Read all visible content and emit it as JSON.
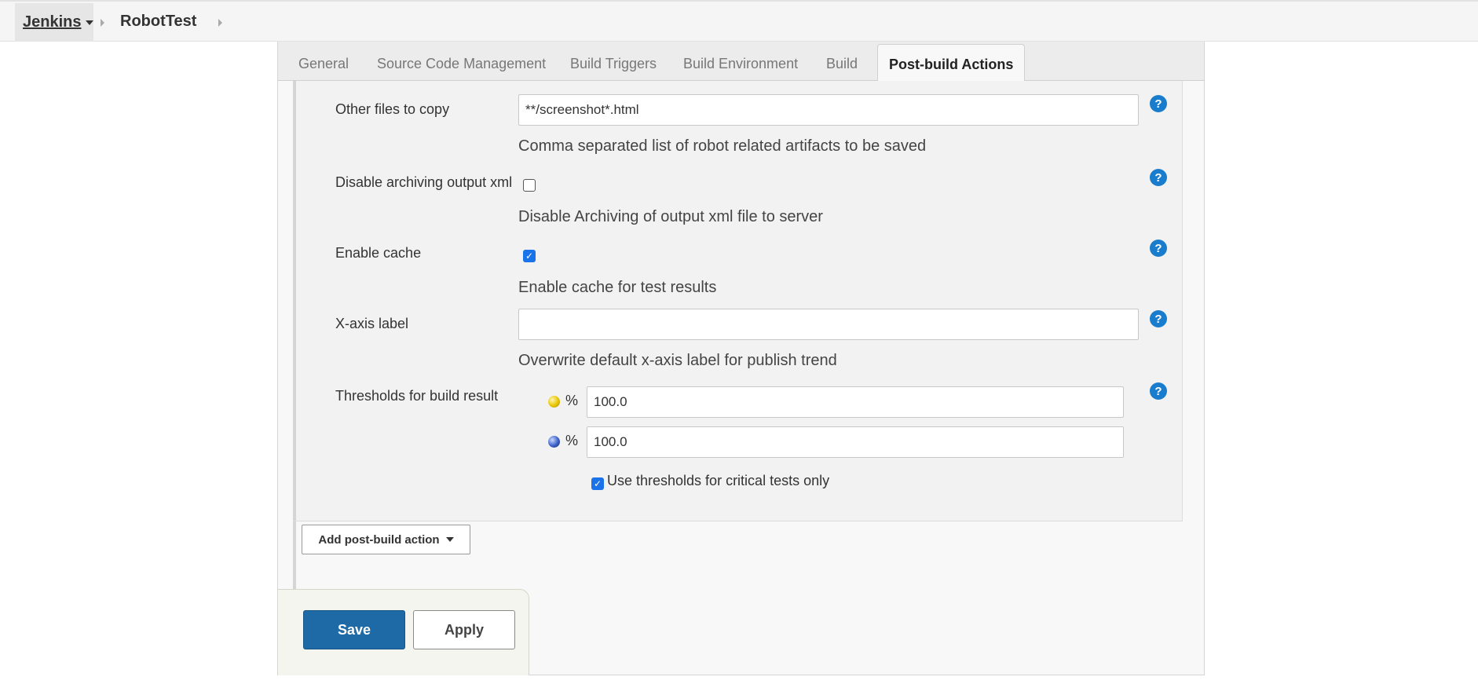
{
  "breadcrumb": {
    "root": "Jenkins",
    "job": "RobotTest"
  },
  "tabs": [
    {
      "label": "General"
    },
    {
      "label": "Source Code Management"
    },
    {
      "label": "Build Triggers"
    },
    {
      "label": "Build Environment"
    },
    {
      "label": "Build"
    },
    {
      "label": "Post-build Actions",
      "active": true
    }
  ],
  "form": {
    "other_files": {
      "label": "Other files to copy",
      "value": "**/screenshot*.html",
      "description": "Comma separated list of robot related artifacts to be saved"
    },
    "disable_archiving": {
      "label": "Disable archiving output xml",
      "checked": false,
      "description": "Disable Archiving of output xml file to server"
    },
    "enable_cache": {
      "label": "Enable cache",
      "checked": true,
      "description": "Enable cache for test results"
    },
    "x_axis_label": {
      "label": "X-axis label",
      "value": "",
      "description": "Overwrite default x-axis label for publish trend"
    },
    "thresholds": {
      "label": "Thresholds for build result",
      "unstable_value": "100.0",
      "pass_value": "100.0",
      "percent_symbol": "%",
      "critical_only_label": "Use thresholds for critical tests only",
      "critical_only_checked": true
    },
    "help_symbol": "?"
  },
  "actions": {
    "add_post_build": "Add post-build action",
    "save": "Save",
    "apply": "Apply"
  },
  "colors": {
    "save_bg": "#1e6aa6",
    "help_bg": "#1a7ccc",
    "checkbox_checked": "#1a73e8"
  }
}
